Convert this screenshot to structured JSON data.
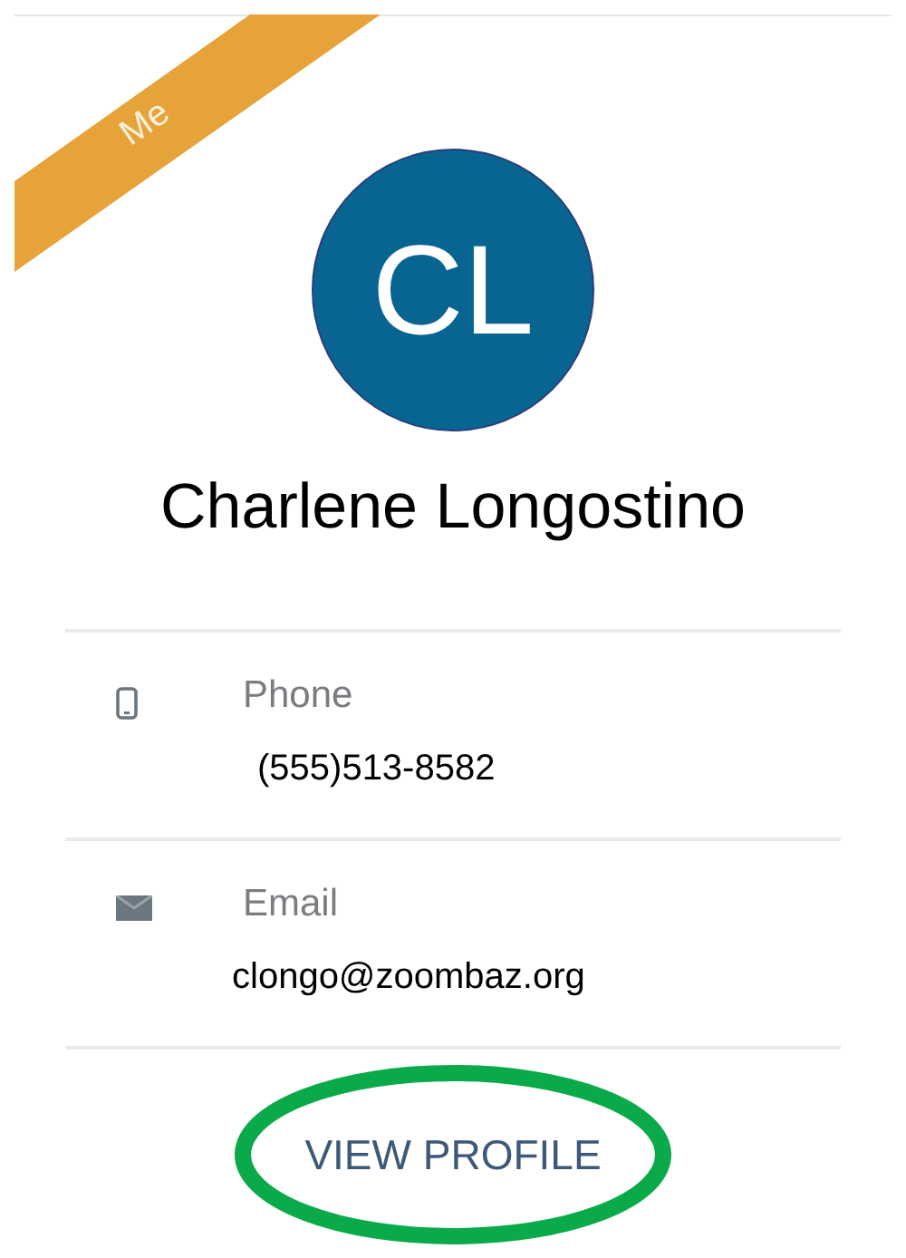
{
  "ribbon": {
    "label": "Me"
  },
  "avatar": {
    "initials": "CL"
  },
  "name": "Charlene Longostino",
  "fields": [
    {
      "kind": "phone",
      "label": "Phone",
      "value": "(555)513-8582"
    },
    {
      "kind": "email",
      "label": "Email",
      "value": "clongo@zoombaz.org"
    }
  ],
  "action": {
    "label": "VIEW PROFILE",
    "highlighted": true
  }
}
